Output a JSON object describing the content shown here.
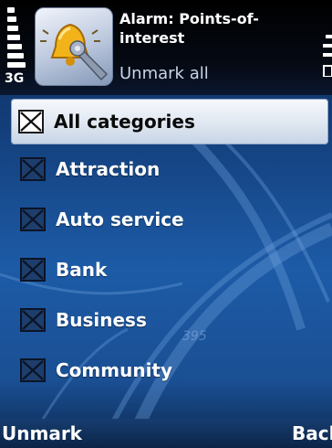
{
  "status_bar": {
    "network_type": "3G",
    "signal_icon": "signal-strength-icon",
    "battery_icon": "battery-icon"
  },
  "header": {
    "app_icon": "alarm-poi-icon",
    "title": "Alarm: Points-of-\ninterest",
    "subtitle": "Unmark all"
  },
  "list": {
    "items": [
      {
        "label": "All categories",
        "checked": true,
        "selected": true
      },
      {
        "label": "Attraction",
        "checked": true,
        "selected": false
      },
      {
        "label": "Auto service",
        "checked": true,
        "selected": false
      },
      {
        "label": "Bank",
        "checked": true,
        "selected": false
      },
      {
        "label": "Business",
        "checked": true,
        "selected": false
      },
      {
        "label": "Community",
        "checked": true,
        "selected": false
      }
    ]
  },
  "background": {
    "map_label": "395"
  },
  "softkeys": {
    "left": "Unmark",
    "right": "Back"
  },
  "colors": {
    "background": "#1d5ba7",
    "highlight": "#dfe7f1",
    "text": "#ffffff"
  }
}
